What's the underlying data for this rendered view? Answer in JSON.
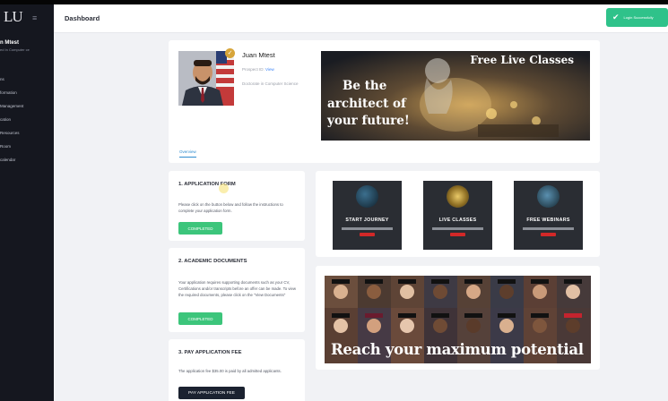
{
  "sidebar": {
    "logo": "LU",
    "menu_icon": "hamburger-icon",
    "user_name": "n Mtest",
    "user_subtitle": "ed In Computer ce",
    "items": [
      {
        "label": "ns"
      },
      {
        "label": "formation"
      },
      {
        "label": "Management"
      },
      {
        "label": "cation"
      },
      {
        "label": "Resources"
      },
      {
        "label": "Room"
      },
      {
        "label": "calendar"
      }
    ]
  },
  "header": {
    "title": "Dashboard"
  },
  "toast": {
    "icon": "check-icon",
    "text": "Login Successfully"
  },
  "profile": {
    "name": "Juan Mtest",
    "student_id_label": "Prospect ID:",
    "view_link": "View",
    "program": "Doctorate in Computer Science",
    "tab_overview": "Overview"
  },
  "banner": {
    "line1": "Be the",
    "line2": "architect of",
    "line3": "your future!",
    "top_right": "Free Live Classes"
  },
  "steps": {
    "step1": {
      "title": "1. APPLICATION FORM",
      "description": "Please click on the button below and follow the instructions to complete your application form.",
      "button": "COMPLETED"
    },
    "step2": {
      "title": "2. ACADEMIC DOCUMENTS",
      "description": "Your application requires supporting documents such as your CV, Certifications and/or transcripts before an offer can be made. To view the required documents, please click on the \"View Documents\"",
      "button": "COMPLETED"
    },
    "step3": {
      "title": "3. PAY APPLICATION FEE",
      "description": "The application fee $35.00 is paid by all admitted applicants.",
      "button": "PAY APPLICATION FEE"
    }
  },
  "promos": [
    {
      "title": "START JOURNEY"
    },
    {
      "title": "LIVE CLASSES"
    },
    {
      "title": "FREE WEBINARS"
    }
  ],
  "graduation_banner": {
    "text": "Reach your maximum potential"
  },
  "colors": {
    "sidebar_bg": "#15171f",
    "accent_green": "#3cc57b",
    "toast_green": "#2fc28a",
    "link_blue": "#2f8ccf",
    "pay_button": "#1b2230"
  }
}
